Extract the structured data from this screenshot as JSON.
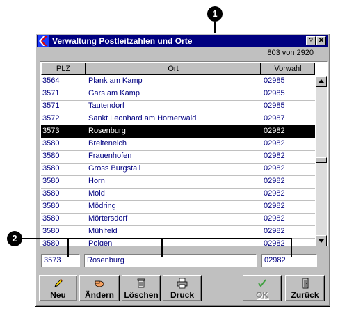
{
  "window": {
    "title": "Verwaltung Postleitzahlen und Orte",
    "help_button": "?",
    "close_button": "✕",
    "record_counter": "803 von 2920"
  },
  "grid": {
    "columns": [
      "PLZ",
      "Ort",
      "Vorwahl"
    ],
    "rows": [
      {
        "plz": "3564",
        "ort": "Plank am Kamp",
        "vorwahl": "02985",
        "selected": false
      },
      {
        "plz": "3571",
        "ort": "Gars am Kamp",
        "vorwahl": "02985",
        "selected": false
      },
      {
        "plz": "3571",
        "ort": "Tautendorf",
        "vorwahl": "02985",
        "selected": false
      },
      {
        "plz": "3572",
        "ort": "Sankt Leonhard am Hornerwald",
        "vorwahl": "02987",
        "selected": false
      },
      {
        "plz": "3573",
        "ort": "Rosenburg",
        "vorwahl": "02982",
        "selected": true
      },
      {
        "plz": "3580",
        "ort": "Breiteneich",
        "vorwahl": "02982",
        "selected": false
      },
      {
        "plz": "3580",
        "ort": "Frauenhofen",
        "vorwahl": "02982",
        "selected": false
      },
      {
        "plz": "3580",
        "ort": "Gross Burgstall",
        "vorwahl": "02982",
        "selected": false
      },
      {
        "plz": "3580",
        "ort": "Horn",
        "vorwahl": "02982",
        "selected": false
      },
      {
        "plz": "3580",
        "ort": "Mold",
        "vorwahl": "02982",
        "selected": false
      },
      {
        "plz": "3580",
        "ort": "Mödring",
        "vorwahl": "02982",
        "selected": false
      },
      {
        "plz": "3580",
        "ort": "Mörtersdorf",
        "vorwahl": "02982",
        "selected": false
      },
      {
        "plz": "3580",
        "ort": "Mühlfeld",
        "vorwahl": "02982",
        "selected": false
      },
      {
        "plz": "3580",
        "ort": "Poigen",
        "vorwahl": "02982",
        "selected": false
      }
    ]
  },
  "edit": {
    "plz": "3573",
    "ort": "Rosenburg",
    "vorwahl": "02982"
  },
  "buttons": {
    "neu": "Neu",
    "aendern": "Ändern",
    "loeschen": "Löschen",
    "druck": "Druck",
    "ok": "OK",
    "zurueck": "Zurück"
  },
  "callouts": {
    "one": "1",
    "two": "2"
  },
  "icons": {
    "app": "app-logo-icon",
    "neu": "pencil-icon",
    "aendern": "hand-edit-icon",
    "loeschen": "trash-icon",
    "druck": "printer-icon",
    "ok": "checkmark-icon",
    "zurueck": "door-exit-icon"
  },
  "colors": {
    "titlebar": "#000080",
    "row_text": "#000080",
    "selected_row": "#000000",
    "window_face": "#c0c0c0"
  }
}
